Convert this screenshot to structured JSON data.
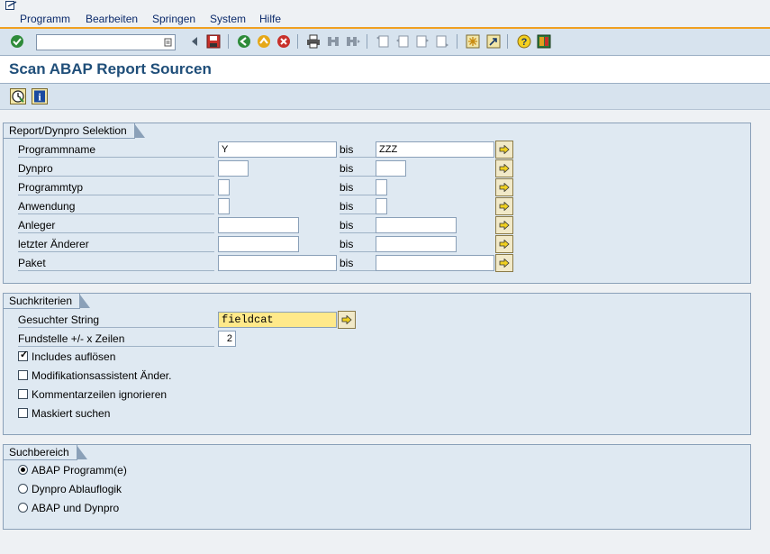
{
  "menu": {
    "items": [
      "Programm",
      "Bearbeiten",
      "Springen",
      "System",
      "Hilfe"
    ]
  },
  "toolbar": {
    "command_value": "",
    "icons": [
      "enter-check-icon",
      "command-history-icon",
      "save-icon",
      "back-icon",
      "exit-icon",
      "cancel-icon",
      "print-icon",
      "find-icon",
      "find-next-icon",
      "first-page-icon",
      "previous-page-icon",
      "next-page-icon",
      "last-page-icon",
      "new-session-icon",
      "shortcut-icon",
      "help-icon",
      "layout-icon"
    ]
  },
  "title": "Scan ABAP Report Sourcen",
  "app_toolbar": {
    "icons": [
      "execute-icon",
      "info-icon"
    ]
  },
  "selection": {
    "title": "Report/Dynpro Selektion",
    "bis_label": "bis",
    "rows": [
      {
        "label": "Programmname",
        "from": "Y",
        "to": "ZZZ"
      },
      {
        "label": "Dynpro",
        "from": "",
        "to": ""
      },
      {
        "label": "Programmtyp",
        "from": "",
        "to": ""
      },
      {
        "label": "Anwendung",
        "from": "",
        "to": ""
      },
      {
        "label": "Anleger",
        "from": "",
        "to": ""
      },
      {
        "label": "letzter Änderer",
        "from": "",
        "to": ""
      },
      {
        "label": "Paket",
        "from": "",
        "to": ""
      }
    ]
  },
  "criteria": {
    "title": "Suchkriterien",
    "search_label": "Gesuchter String",
    "search_value": "fieldcat",
    "lines_label": "Fundstelle +/- x Zeilen",
    "lines_value": "2",
    "checkboxes": [
      {
        "label": "Includes auflösen",
        "checked": true
      },
      {
        "label": "Modifikationsassistent Änder.",
        "checked": false
      },
      {
        "label": "Kommentarzeilen ignorieren",
        "checked": false
      },
      {
        "label": "Maskiert suchen",
        "checked": false
      }
    ]
  },
  "scope": {
    "title": "Suchbereich",
    "radios": [
      {
        "label": "ABAP Programm(e)",
        "selected": true
      },
      {
        "label": "Dynpro Ablauflogik",
        "selected": false
      },
      {
        "label": "ABAP und Dynpro",
        "selected": false
      }
    ]
  },
  "colors": {
    "accent_orange": "#f0a020",
    "title_blue": "#1f4e79",
    "highlight_yellow": "#ffe98a"
  }
}
